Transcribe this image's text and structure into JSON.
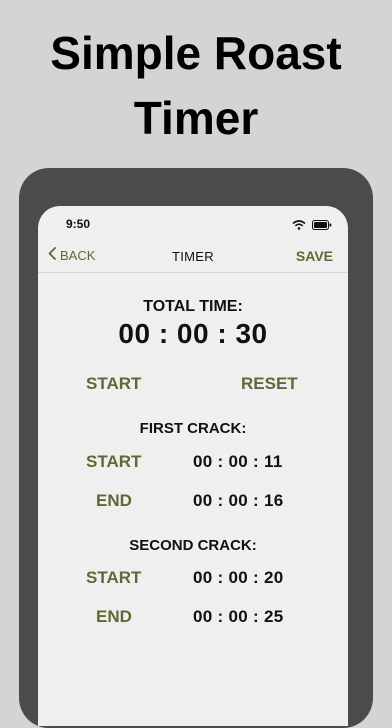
{
  "headline": {
    "line1": "Simple Roast",
    "line2": "Timer"
  },
  "status_bar": {
    "time": "9:50"
  },
  "nav": {
    "back_label": "BACK",
    "title": "TIMER",
    "save_label": "SAVE"
  },
  "total": {
    "label": "TOTAL TIME:",
    "value": "00 : 00 : 30",
    "start_label": "START",
    "reset_label": "RESET"
  },
  "first_crack": {
    "label": "FIRST CRACK:",
    "start_label": "START",
    "start_time": "00 : 00 : 11",
    "end_label": "END",
    "end_time": "00 : 00 : 16"
  },
  "second_crack": {
    "label": "SECOND CRACK:",
    "start_label": "START",
    "start_time": "00 : 00 : 20",
    "end_label": "END",
    "end_time": "00 : 00 : 25"
  },
  "colors": {
    "accent": "#5c6b35",
    "frame": "#4b4b4b",
    "background": "#d4d4d4"
  }
}
